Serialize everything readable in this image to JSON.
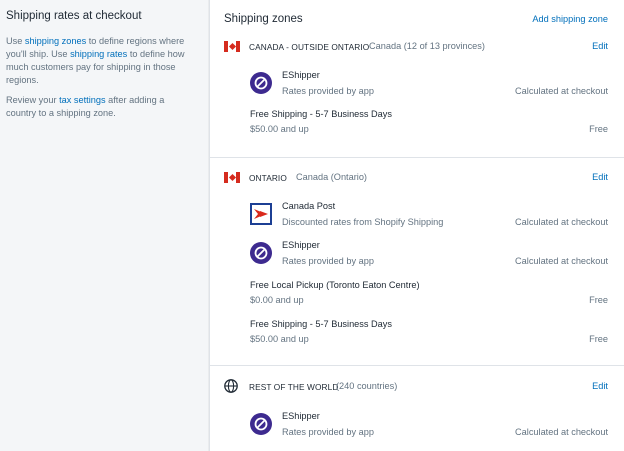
{
  "sidebar": {
    "title": "Shipping rates at checkout",
    "p1": {
      "t1": "Use ",
      "link1": "shipping zones",
      "t2": " to define regions where you'll ship. Use ",
      "link2": "shipping rates",
      "t3": " to define how much customers pay for shipping in those regions."
    },
    "p2": {
      "t1": "Review your ",
      "link": "tax settings",
      "t2": " after adding a country to a shipping zone."
    }
  },
  "card": {
    "title": "Shipping zones",
    "add_label": "Add shipping zone"
  },
  "zones": [
    {
      "name": "CANADA - OUTSIDE ONTARIO",
      "sub": "Canada (12 of 13 provinces)",
      "edit": "Edit",
      "icon": "canada-flag-icon",
      "methods": [
        {
          "name": "EShipper",
          "desc": "Rates provided by app",
          "calc": "Calculated at checkout",
          "icon": "eshipper-logo-icon"
        }
      ],
      "rates": [
        {
          "name": "Free Shipping - 5-7 Business Days",
          "cond": "$50.00 and up",
          "price": "Free"
        }
      ]
    },
    {
      "name": "ONTARIO",
      "sub": "Canada (Ontario)",
      "edit": "Edit",
      "icon": "canada-flag-icon",
      "methods": [
        {
          "name": "Canada Post",
          "desc": "Discounted rates from Shopify Shipping",
          "calc": "Calculated at checkout",
          "icon": "canada-post-logo-icon"
        },
        {
          "name": "EShipper",
          "desc": "Rates provided by app",
          "calc": "Calculated at checkout",
          "icon": "eshipper-logo-icon"
        }
      ],
      "rates": [
        {
          "name": "Free Local Pickup (Toronto Eaton Centre)",
          "cond": "$0.00 and up",
          "price": "Free"
        },
        {
          "name": "Free Shipping - 5-7 Business Days",
          "cond": "$50.00 and up",
          "price": "Free"
        }
      ]
    },
    {
      "name": "REST OF THE WORLD",
      "sub": "(240 countries)",
      "edit": "Edit",
      "icon": "globe-icon",
      "methods": [
        {
          "name": "EShipper",
          "desc": "Rates provided by app",
          "calc": "Calculated at checkout",
          "icon": "eshipper-logo-icon"
        }
      ],
      "rates": []
    }
  ],
  "colors": {
    "link": "#006fbb",
    "flag_red": "#d52b1e",
    "eshipper": "#3d2a8f",
    "canada_post_red": "#da291c",
    "canada_post_blue": "#1c3f94"
  }
}
